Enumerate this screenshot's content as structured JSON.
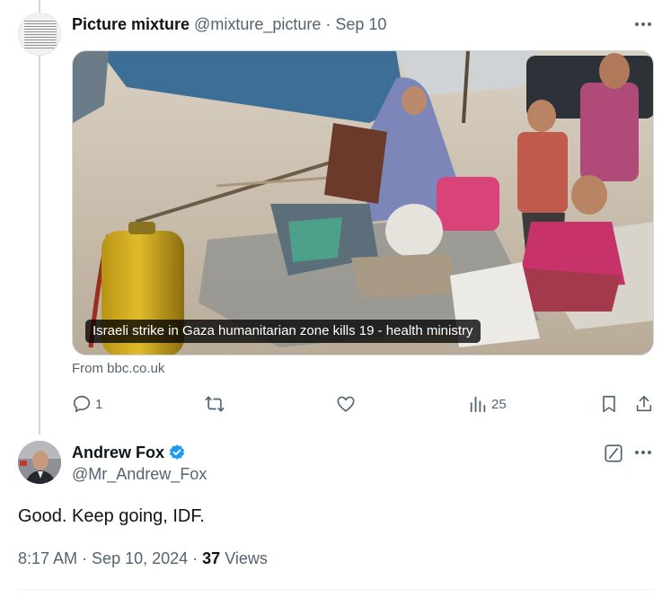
{
  "quoted_post": {
    "display_name": "Picture mixture",
    "handle": "@mixture_picture",
    "dot": "·",
    "date": "Sep 10",
    "media_caption": "Israeli strike in Gaza humanitarian zone kills 19 - health ministry",
    "source": "From bbc.co.uk",
    "actions": {
      "reply_icon": "reply-icon",
      "reply_count": "1",
      "repost_icon": "repost-icon",
      "like_icon": "heart-icon",
      "views_icon": "analytics-icon",
      "views_count": "25",
      "bookmark_icon": "bookmark-icon",
      "share_icon": "share-icon"
    }
  },
  "main_post": {
    "display_name": "Andrew Fox",
    "handle": "@Mr_Andrew_Fox",
    "text": "Good. Keep going, IDF.",
    "time": "8:17 AM",
    "dot1": "·",
    "date": "Sep 10, 2024",
    "dot2": "·",
    "views_count": "37",
    "views_label": "Views"
  },
  "colors": {
    "text_primary": "#0f1419",
    "text_secondary": "#536471",
    "verified_blue": "#1d9bf0",
    "divider": "#eff3f4"
  }
}
